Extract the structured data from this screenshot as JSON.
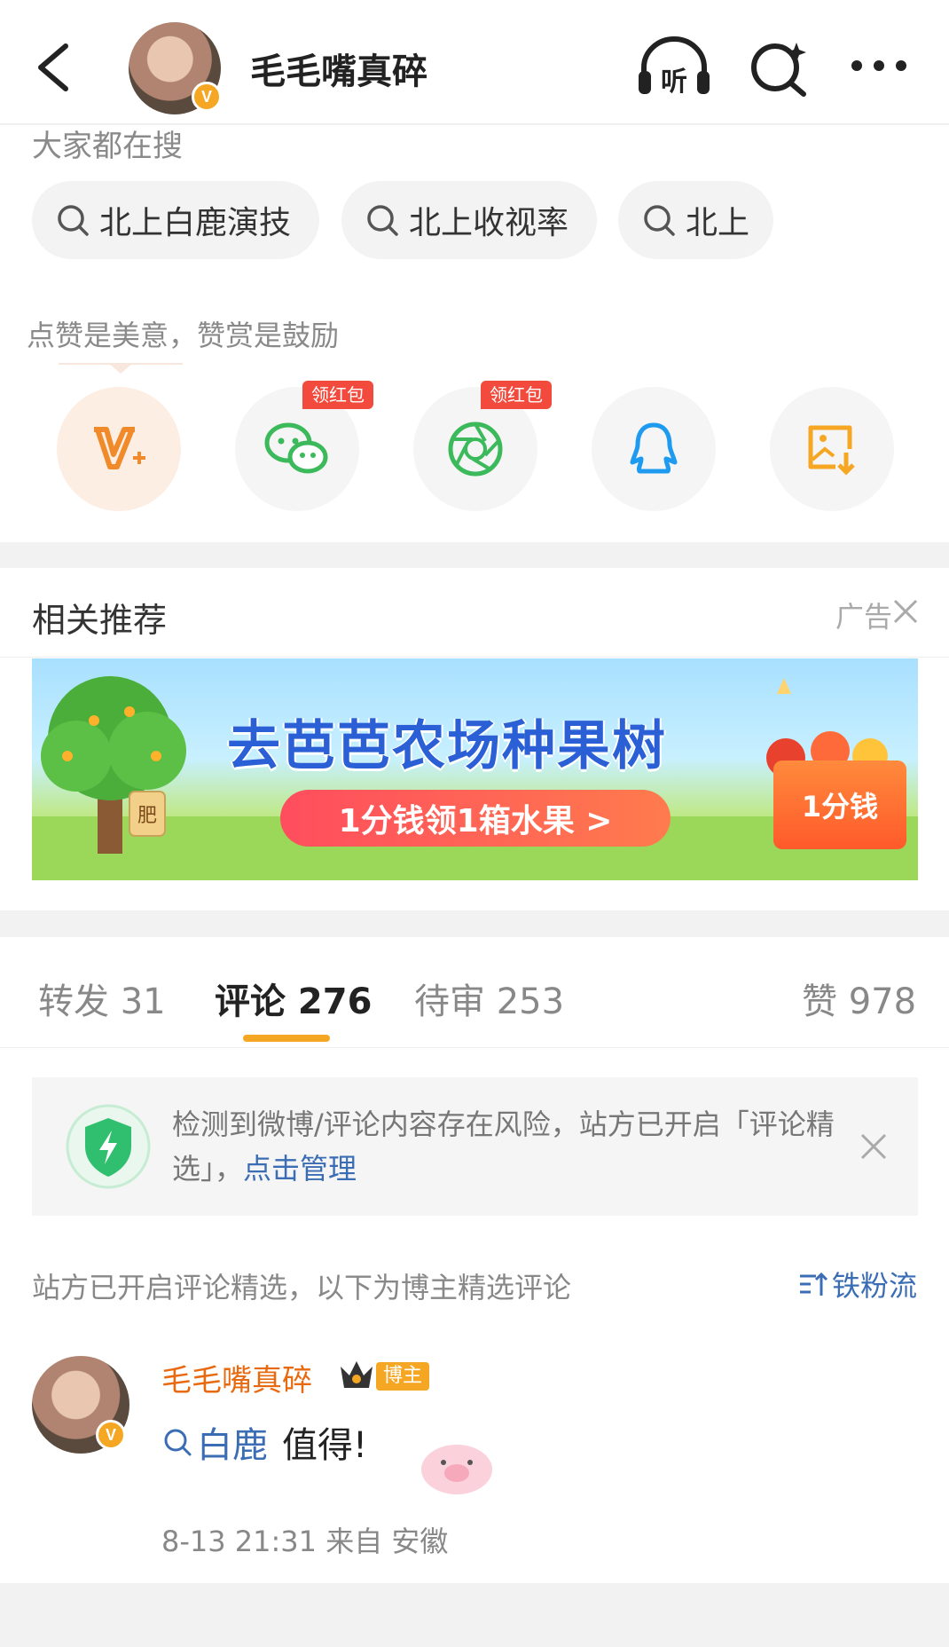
{
  "header": {
    "title": "毛毛嘴真碎",
    "verified_badge": "V",
    "icons": [
      "back-icon",
      "listen-icon",
      "ai-search-icon",
      "more-icon"
    ],
    "listen_label": "听"
  },
  "trending": {
    "label": "大家都在搜",
    "chips": [
      "北上白鹿演技",
      "北上收视率",
      "北上"
    ]
  },
  "reward": {
    "label": "点赞是美意，赞赏是鼓励",
    "share_targets": [
      {
        "icon": "v-plus-icon",
        "tag": ""
      },
      {
        "icon": "wechat-icon",
        "tag": "领红包"
      },
      {
        "icon": "moments-icon",
        "tag": "领红包"
      },
      {
        "icon": "qq-icon",
        "tag": ""
      },
      {
        "icon": "save-image-icon",
        "tag": ""
      }
    ]
  },
  "recommend": {
    "title": "相关推荐",
    "ad_label": "广告",
    "banner": {
      "headline": "去芭芭农场种果树",
      "cta": "1分钱领1箱水果 >",
      "box_text": "1分钱",
      "fertilizer": "肥"
    }
  },
  "tabs": [
    {
      "label": "转发 31",
      "active": false
    },
    {
      "label": "评论 276",
      "active": true
    },
    {
      "label": "待审 253",
      "active": false
    },
    {
      "label": "赞 978",
      "active": false
    }
  ],
  "notice": {
    "text": "检测到微博/评论内容存在风险，站方已开启「评论精选」，",
    "link": "点击管理"
  },
  "comments_header": {
    "note": "站方已开启评论精选，以下为博主精选评论",
    "sort_label": "铁粉流"
  },
  "comment": {
    "author": "毛毛嘴真碎",
    "badge": "博主",
    "keyword": "白鹿",
    "text": "值得!",
    "meta": "8-13 21:31 来自 安徽"
  },
  "colors": {
    "accent_orange": "#f5a623",
    "link_blue": "#3b6db5",
    "red_tag": "#f24b3e",
    "wechat_green": "#3cb95a",
    "qq_blue": "#1e9bf0"
  }
}
